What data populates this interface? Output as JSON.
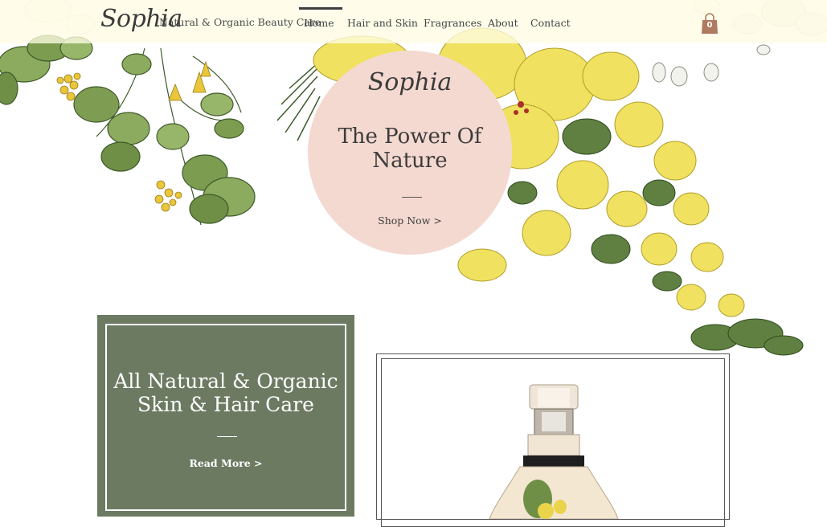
{
  "brand": {
    "logo": "Sophia",
    "tagline": "Natural & Organic Beauty Care"
  },
  "nav": {
    "items": [
      {
        "label": "Home",
        "active": true
      },
      {
        "label": "Hair and Skin",
        "active": false
      },
      {
        "label": "Fragrances",
        "active": false
      },
      {
        "label": "About",
        "active": false
      },
      {
        "label": "Contact",
        "active": false
      }
    ]
  },
  "cart": {
    "count": "0",
    "icon": "shopping-bag-icon"
  },
  "hero": {
    "logo": "Sophia",
    "title": "The Power Of Nature",
    "cta": "Shop Now >"
  },
  "promo": {
    "title": "All Natural & Organic Skin & Hair Care",
    "cta": "Read More >"
  },
  "colors": {
    "header_bg": "#fffce4",
    "hero_circle": "#f4d9d1",
    "promo_bg": "#6d7a62",
    "cart": "#b07a62",
    "flower_yellow": "#efe05a",
    "leaf_green": "#6e8f45"
  }
}
